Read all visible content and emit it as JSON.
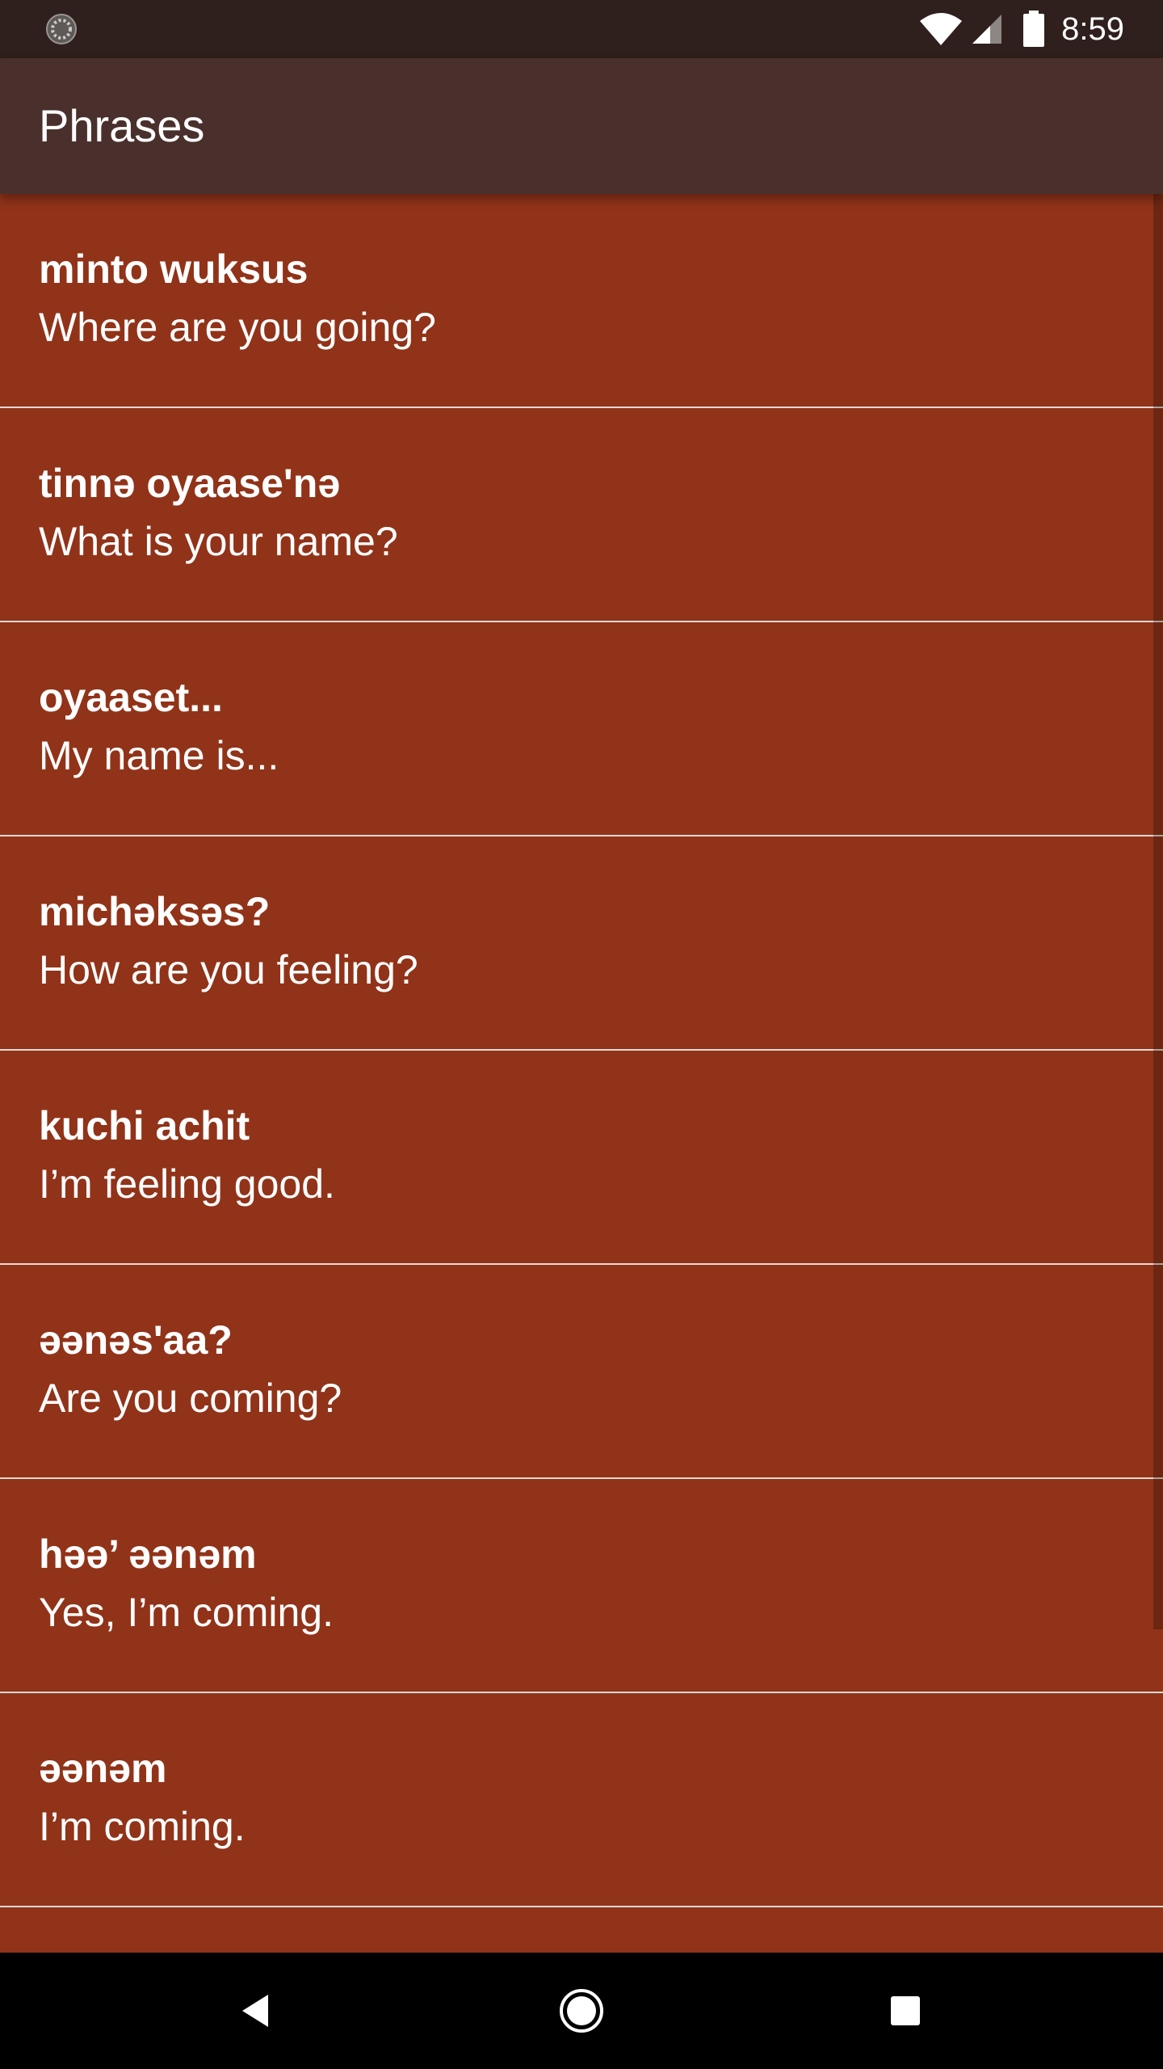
{
  "status_bar": {
    "time": "8:59",
    "icons": [
      "loading-icon",
      "wifi-icon",
      "signal-icon",
      "battery-icon"
    ]
  },
  "app_bar": {
    "title": "Phrases"
  },
  "phrases": [
    {
      "native": "minto wuksus",
      "english": "Where are you going?"
    },
    {
      "native": "tinnə oyaase'nə",
      "english": "What is your name?"
    },
    {
      "native": "oyaaset...",
      "english": "My name is..."
    },
    {
      "native": "michəksəs?",
      "english": "How are you feeling?"
    },
    {
      "native": "kuchi achit",
      "english": "I’m feeling good."
    },
    {
      "native": "əənəs'aa?",
      "english": "Are you coming?"
    },
    {
      "native": "həə’ əənəm",
      "english": "Yes, I’m coming."
    },
    {
      "native": "əənəm",
      "english": "I’m coming."
    }
  ],
  "nav_bar": {
    "icons": [
      "back-icon",
      "home-icon",
      "recents-icon"
    ]
  },
  "colors": {
    "status_bar": "#2f1f1d",
    "app_bar": "#4a302c",
    "list_background": "#913319",
    "divider": "#e8d9d3",
    "text": "#ffffff"
  }
}
